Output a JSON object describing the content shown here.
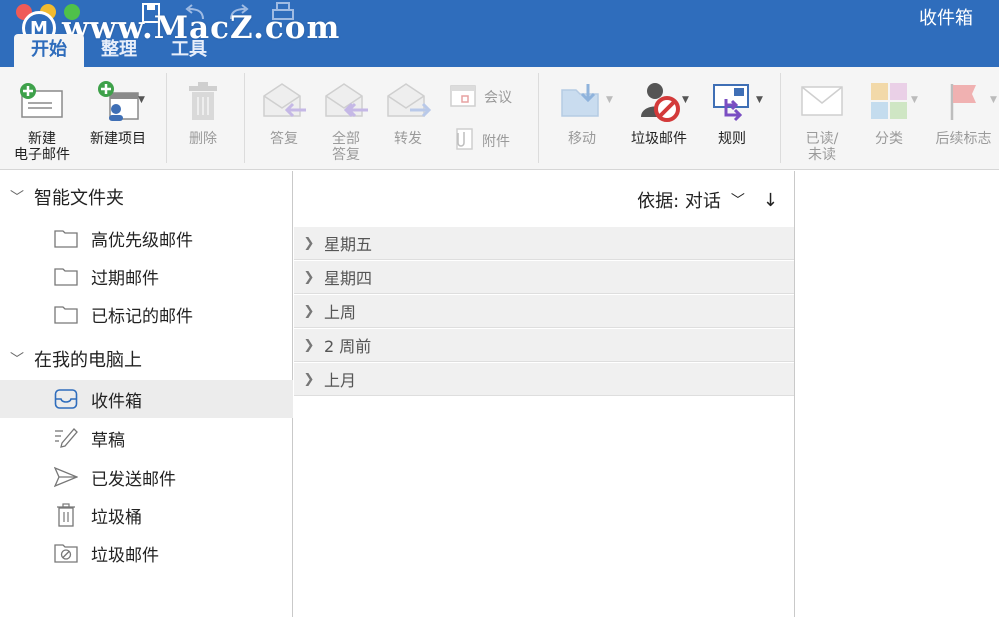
{
  "window": {
    "title": "收件箱"
  },
  "watermark": {
    "logo": "M",
    "text": "www.MacZ.com"
  },
  "tabs": [
    {
      "label": "开始",
      "active": true
    },
    {
      "label": "整理",
      "active": false
    },
    {
      "label": "工具",
      "active": false
    }
  ],
  "ribbon": {
    "new_email": "新建\n电子邮件",
    "new_item": "新建项目",
    "delete": "删除",
    "reply": "答复",
    "reply_all": "全部\n答复",
    "forward": "转发",
    "meeting": "会议",
    "attachment": "附件",
    "move": "移动",
    "junk": "垃圾邮件",
    "rules": "规则",
    "read_unread": "已读/\n未读",
    "categorize": "分类",
    "follow_up": "后续标志"
  },
  "sidebar": {
    "smart_folders": {
      "label": "智能文件夹",
      "items": [
        "高优先级邮件",
        "过期邮件",
        "已标记的邮件"
      ]
    },
    "on_my_computer": {
      "label": "在我的电脑上",
      "items": [
        "收件箱",
        "草稿",
        "已发送邮件",
        "垃圾桶",
        "垃圾邮件"
      ]
    },
    "selected": "收件箱"
  },
  "message_list": {
    "sort_label": "依据: 对话",
    "groups": [
      "星期五",
      "星期四",
      "上周",
      "2 周前",
      "上月"
    ]
  },
  "colors": {
    "accent": "#2f6dbc",
    "ribbon": "#f5f5f5",
    "selected": "#ececec"
  }
}
